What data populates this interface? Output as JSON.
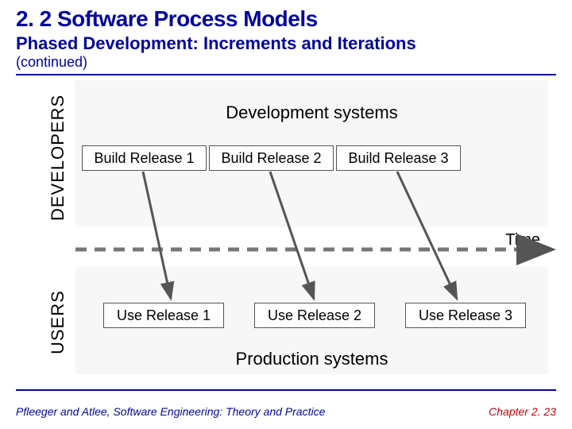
{
  "header": {
    "title": "2. 2 Software Process Models",
    "subtitle": "Phased Development: Increments and Iterations",
    "continued": "(continued)"
  },
  "diagram": {
    "developers_label": "DEVELOPERS",
    "users_label": "USERS",
    "dev_systems_title": "Development systems",
    "prod_systems_title": "Production systems",
    "time_label": "Time",
    "build_boxes": [
      "Build Release 1",
      "Build Release 2",
      "Build Release 3"
    ],
    "use_boxes": [
      "Use Release 1",
      "Use Release 2",
      "Use Release 3"
    ]
  },
  "footer": {
    "left": "Pfleeger and Atlee, Software Engineering: Theory and Practice",
    "right": "Chapter 2. 23"
  }
}
